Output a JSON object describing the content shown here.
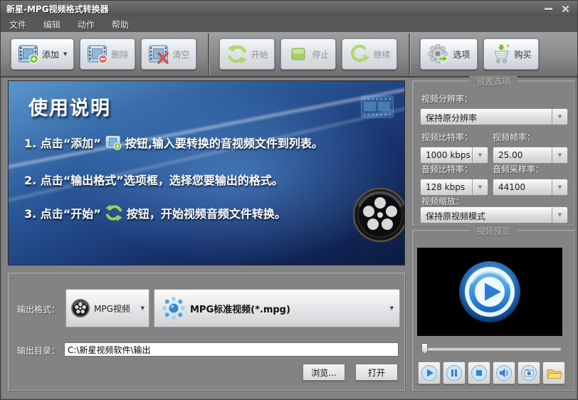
{
  "window": {
    "title": "新星-MPG视频格式转换器"
  },
  "menu": {
    "items": [
      {
        "label": "文件"
      },
      {
        "label": "编辑"
      },
      {
        "label": "动作"
      },
      {
        "label": "帮助"
      }
    ]
  },
  "toolbar": {
    "add": "添加",
    "delete": "删除",
    "clear": "清空",
    "start": "开始",
    "stop": "停止",
    "resume": "继续",
    "options": "选项",
    "buy": "购买"
  },
  "instructions": {
    "title": "使用说明",
    "step1_pre": "1. 点击“添加”",
    "step1_post": "按钮,输入要转换的音视频文件到列表。",
    "step2": "2. 点击“输出格式”选项框，选择您要输出的格式。",
    "step3_pre": "3. 点击“开始”",
    "step3_post": "按钮，开始视频音频文件转换。"
  },
  "presets": {
    "title": "预置选项",
    "resolution_label": "视频分辨率：",
    "resolution_value": "保持原分辨率",
    "video_bitrate_label": "视频比特率：",
    "video_bitrate_value": "1000 kbps",
    "frame_rate_label": "视频帧率：",
    "frame_rate_value": "25.00",
    "audio_bitrate_label": "音频比特率：",
    "audio_bitrate_value": "128 kbps",
    "sample_rate_label": "音频采样率：",
    "sample_rate_value": "44100",
    "scale_label": "视频缩放：",
    "scale_value": "保持原视频模式"
  },
  "preview": {
    "title": "视频预览"
  },
  "output": {
    "format_label": "输出格式：",
    "format_type": "MPG视频",
    "format_profile": "MPG标准视频(*.mpg)",
    "dir_label": "输出目录：",
    "dir_value": "C:\\新星视频软件\\输出",
    "browse_label": "浏览...",
    "open_label": "打开"
  },
  "icons": {
    "dropdown_arrow": "▼",
    "caret": "▼"
  },
  "colors": {
    "accent_green": "#8cc63f",
    "panel_blue": "#17316d",
    "toolbar_gray": "#8a8a8a"
  }
}
